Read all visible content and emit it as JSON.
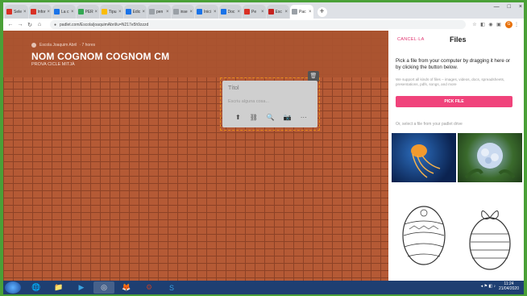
{
  "browser": {
    "tabs": [
      {
        "label": "Sele",
        "color": "#d93025"
      },
      {
        "label": "Infor",
        "color": "#d93025"
      },
      {
        "label": "La c",
        "color": "#1a73e8"
      },
      {
        "label": "PER",
        "color": "#34a853"
      },
      {
        "label": "Tipu",
        "color": "#fbbc04"
      },
      {
        "label": "Edic",
        "color": "#1a73e8"
      },
      {
        "label": "pen",
        "color": "#9aa0a6"
      },
      {
        "label": "inse",
        "color": "#9aa0a6"
      },
      {
        "label": "Inici",
        "color": "#1a73e8"
      },
      {
        "label": "Doc",
        "color": "#1a73e8"
      },
      {
        "label": "Pe",
        "color": "#d93025"
      },
      {
        "label": "Esc",
        "color": "#c5221f"
      },
      {
        "label": "Pac",
        "color": "#9aa0a6"
      }
    ],
    "tab_close": "×",
    "new_tab": "+",
    "url": "padlet.com/Escola/joaquimAbril/u=N217e5h9zzzd",
    "profile_initial": "G",
    "window_controls": [
      "—",
      "□",
      "×"
    ]
  },
  "padlet": {
    "author": "Escola Joaquim Abril",
    "time": "· 7 hores",
    "title": "NOM COGNOM COGNOM CM",
    "subtitle": "PROVA CICLE MITJÀ",
    "post": {
      "title_placeholder": "Títol",
      "body_placeholder": "Escriu alguna cosa...",
      "actions": [
        "⬆",
        "⛓",
        "🔍",
        "📷",
        "···"
      ],
      "delete_icon": "🗑"
    }
  },
  "filepanel": {
    "cancel": "CANCEL·LA",
    "title": "Files",
    "description": "Pick a file from your computer by dragging it here or by clicking the button below.",
    "support": "We support all kinds of files – images, videos, docs, spreadsheets, presentations, pdfs, songs, and more",
    "pick_button": "PICK FILE",
    "or_text": "Or, select a file from your padlet drive"
  },
  "taskbar": {
    "time": "11:24",
    "date": "21/04/2020",
    "items": [
      "🌐",
      "📁",
      "▶",
      "◎",
      "🦊",
      "⚙",
      "S"
    ]
  },
  "colors": {
    "accent": "#f0437b",
    "brick": "#b55a35"
  }
}
